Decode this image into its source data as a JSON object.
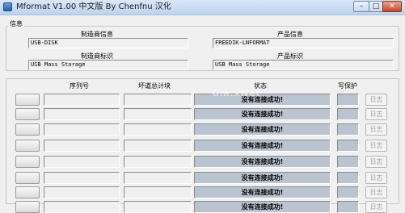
{
  "window": {
    "title": "Mformat V1.00 中文版 By Chenfnu 汉化",
    "minimize_glyph": "–",
    "maximize_glyph": "□",
    "close_glyph": "✕"
  },
  "info": {
    "group_label": "信息",
    "manufacturer_info_label": "制造商信息",
    "manufacturer_info_value": "USB-DISK",
    "product_info_label": "产品信息",
    "product_info_value": "FREEDIK-LNFORMAT",
    "manufacturer_id_label": "制造商标识",
    "manufacturer_id_value": "USB Mass Storage",
    "product_id_label": "产品标识",
    "product_id_value": "USB Mass Storage"
  },
  "devices": {
    "headers": {
      "serial": "序列号",
      "bad_blocks": "坏道总计块",
      "status": "状态",
      "write_protect": "写保护"
    },
    "watermark": "Gm.xNet",
    "rows": [
      {
        "status": "没有连接成功!",
        "log": "日志"
      },
      {
        "status": "没有连接成功!",
        "log": "日志"
      },
      {
        "status": "没有连接成功!",
        "log": "日志"
      },
      {
        "status": "没有连接成功!",
        "log": "日志"
      },
      {
        "status": "没有连接成功!",
        "log": "日志"
      },
      {
        "status": "没有连接成功!",
        "log": "日志"
      },
      {
        "status": "没有连接成功!",
        "log": "日志"
      },
      {
        "status": "没有连接成功!",
        "log": "日志"
      }
    ]
  },
  "colors": {
    "status_cell": "#b9c4d0",
    "window_bg": "#f0f0f0",
    "titlebar": "#bcd3ee",
    "close_button": "#c7462b"
  }
}
